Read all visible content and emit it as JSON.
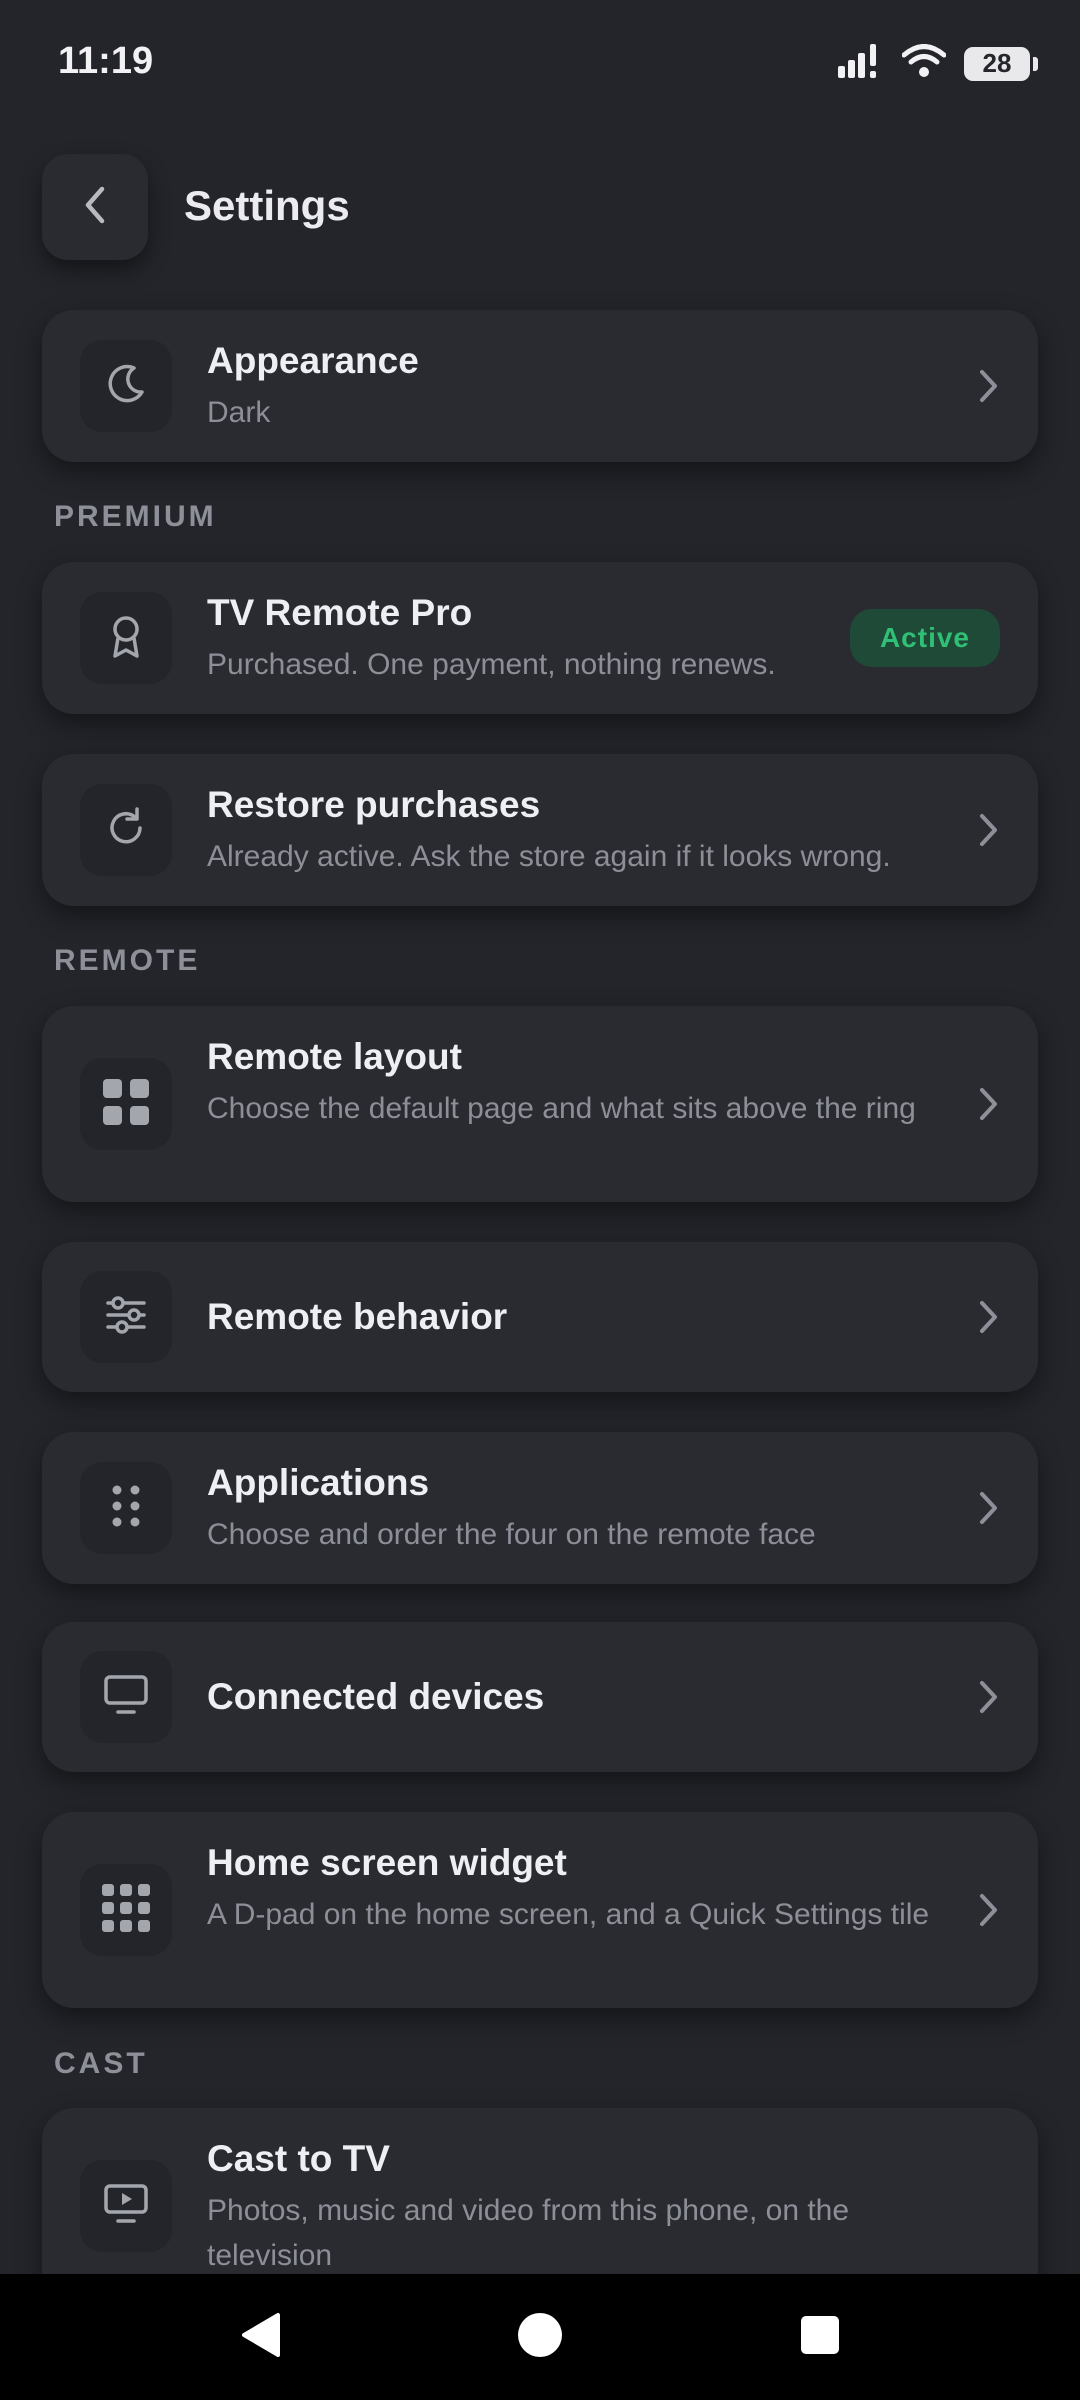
{
  "status": {
    "time": "11:19",
    "battery": "28"
  },
  "header": {
    "title": "Settings"
  },
  "appearance": {
    "title": "Appearance",
    "subtitle": "Dark"
  },
  "premium": {
    "section_label": "PREMIUM",
    "pro": {
      "title": "TV Remote Pro",
      "subtitle": "Purchased. One payment, nothing renews.",
      "badge": "Active"
    },
    "restore": {
      "title": "Restore purchases",
      "subtitle": "Already active. Ask the store again if it looks wrong."
    }
  },
  "remote": {
    "section_label": "REMOTE",
    "layout": {
      "title": "Remote layout",
      "subtitle": "Choose the default page and what sits above the ring"
    },
    "behavior": {
      "title": "Remote behavior"
    },
    "applications": {
      "title": "Applications",
      "subtitle": "Choose and order the four on the remote face"
    },
    "devices": {
      "title": "Connected devices"
    },
    "widget": {
      "title": "Home screen widget",
      "subtitle": "A D-pad on the home screen, and a Quick Settings tile"
    }
  },
  "cast": {
    "section_label": "CAST",
    "cast_tv": {
      "title": "Cast to TV",
      "subtitle": "Photos, music and video from this phone, on the television"
    }
  },
  "colors": {
    "background": "#24252b",
    "card": "#2a2b31",
    "accent_green": "#2fc076",
    "muted_text": "#8d8f98"
  }
}
